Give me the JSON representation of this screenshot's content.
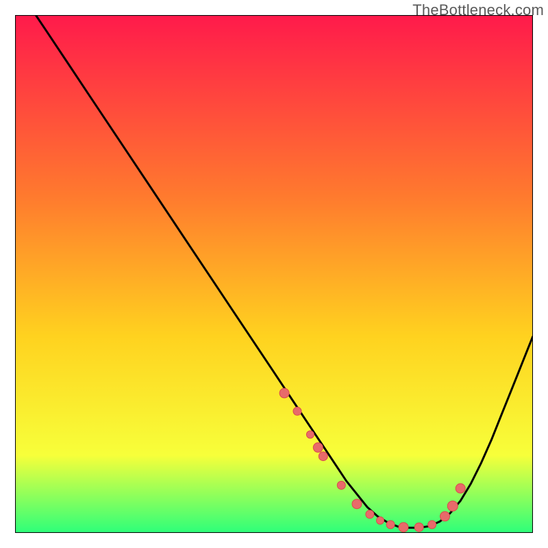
{
  "watermark": "TheBottleneck.com",
  "colors": {
    "gradient_top": "#ff1a4b",
    "gradient_mid1": "#ff7a2e",
    "gradient_mid2": "#ffd21f",
    "gradient_mid3": "#f7ff3a",
    "gradient_bottom": "#2dff7a",
    "curve": "#000000",
    "dot_fill": "#e86a6a",
    "dot_stroke": "#d94b4b",
    "frame": "#000000"
  },
  "chart_data": {
    "type": "line",
    "title": "",
    "xlabel": "",
    "ylabel": "",
    "xlim": [
      0,
      100
    ],
    "ylim": [
      0,
      100
    ],
    "grid": false,
    "legend": false,
    "series": [
      {
        "name": "bottleneck-curve",
        "x": [
          4,
          6,
          10,
          14,
          18,
          22,
          26,
          30,
          34,
          38,
          42,
          46,
          50,
          54,
          58,
          60,
          62,
          64,
          66,
          68,
          70,
          72,
          74,
          76,
          78,
          80,
          82,
          84,
          86,
          88,
          90,
          92,
          94,
          96,
          98,
          100
        ],
        "y": [
          100,
          97,
          91,
          85,
          79,
          73,
          67,
          61,
          55,
          49,
          43,
          37,
          31,
          25,
          19,
          16,
          13,
          10,
          7.5,
          5,
          3.2,
          2,
          1.2,
          1,
          1,
          1.3,
          2.2,
          3.8,
          6.2,
          9.5,
          13.5,
          18,
          23,
          28,
          33,
          38
        ]
      }
    ],
    "markers": {
      "name": "highlight-dots",
      "x": [
        52,
        54.5,
        57,
        58.5,
        59.5,
        63,
        66,
        68.5,
        70.5,
        72.5,
        75,
        78,
        80.5,
        83,
        84.5,
        86
      ],
      "y": [
        27,
        23.5,
        19,
        16.5,
        14.8,
        9.2,
        5.6,
        3.6,
        2.4,
        1.6,
        1.1,
        1.1,
        1.6,
        3.2,
        5.2,
        8.6
      ],
      "r": [
        7,
        6,
        5.5,
        7,
        6.5,
        6,
        7,
        6,
        5.5,
        6,
        7,
        6.5,
        6,
        7,
        7.5,
        7
      ]
    }
  }
}
